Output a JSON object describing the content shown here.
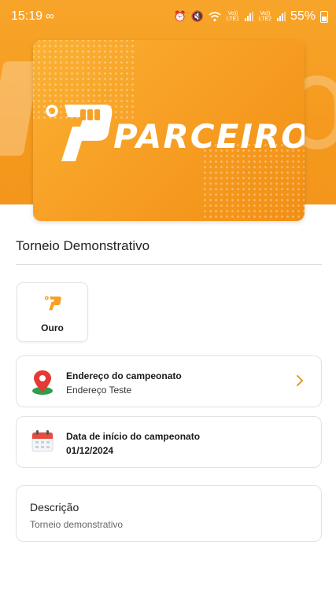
{
  "status_bar": {
    "time": "15:19",
    "lte1": "Vo)) LTE1",
    "lte2": "Vo)) LTE2",
    "battery": "55%"
  },
  "banner": {
    "logo_text": "PARCEIRO",
    "logo_prefix": "o"
  },
  "page": {
    "title": "Torneio Demonstrativo"
  },
  "tier": {
    "label": "Ouro",
    "icon": "parceiro-logo-icon"
  },
  "address_card": {
    "label": "Endereço do campeonato",
    "value": "Endereço Teste",
    "icon": "location-pin-icon"
  },
  "date_card": {
    "label": "Data de início do campeonato",
    "value": "01/12/2024",
    "icon": "calendar-icon"
  },
  "description": {
    "title": "Descrição",
    "text": "Torneio demonstrativo"
  },
  "colors": {
    "brand_orange": "#f7a025",
    "pin_red": "#e53935",
    "pin_green": "#2e9d4a",
    "calendar_red": "#e74c3c"
  }
}
